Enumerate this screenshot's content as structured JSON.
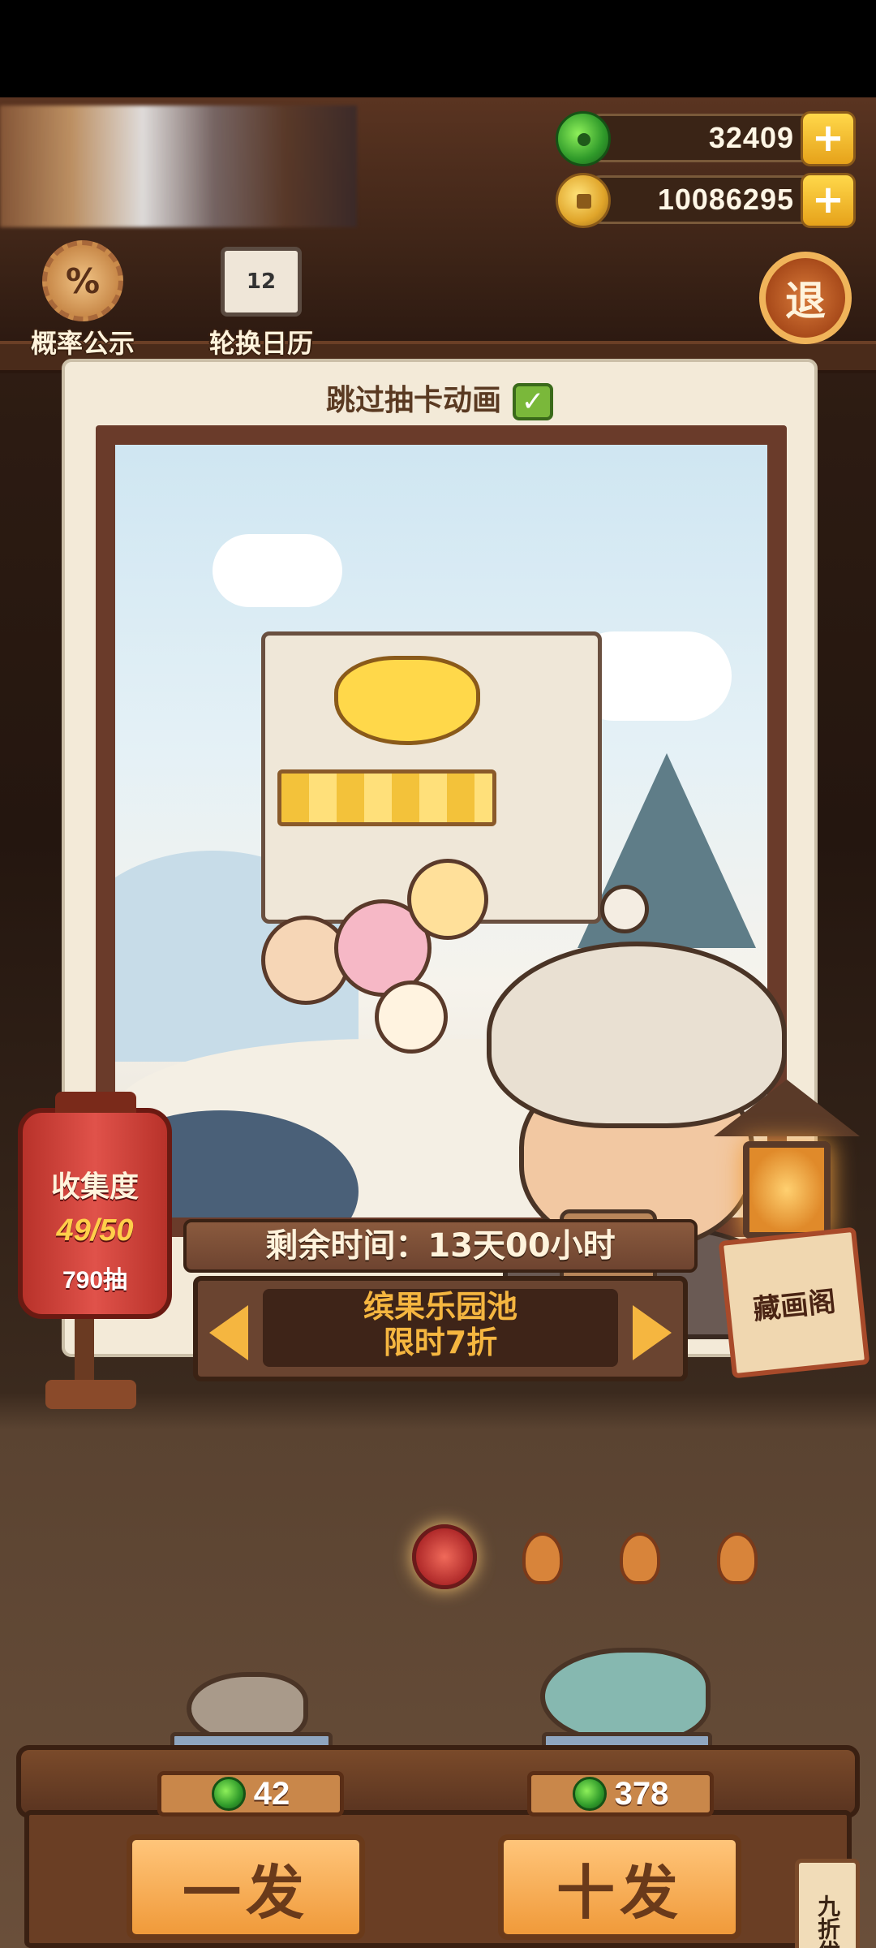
{
  "currency": {
    "jade_value": "32409",
    "coin_value": "10086295",
    "plus": "+"
  },
  "top_buttons": {
    "probability_label": "概率公示",
    "probability_icon_text": "%",
    "calendar_label": "轮换日历",
    "calendar_icon_text": "12",
    "exit_label": "退"
  },
  "frame": {
    "skip_label": "跳过抽卡动画",
    "skip_checked": true
  },
  "collection": {
    "title": "收集度",
    "progress": "49/50",
    "pulls": "790抽"
  },
  "banner": {
    "remaining": "剩余时间：13天00小时",
    "pool_name": "缤果乐园池",
    "discount": "限时7折"
  },
  "gallery_label": "藏画阁",
  "pool_dots": {
    "count": 4,
    "selected": 0
  },
  "pulls": {
    "single_price": "42",
    "single_label": "一发",
    "ten_price": "378",
    "ten_label": "十发",
    "discount_tag": "九折优惠"
  },
  "colors": {
    "accent_gold": "#f5b640",
    "lantern_red": "#e0524a",
    "button_orange": "#f09a3a"
  }
}
